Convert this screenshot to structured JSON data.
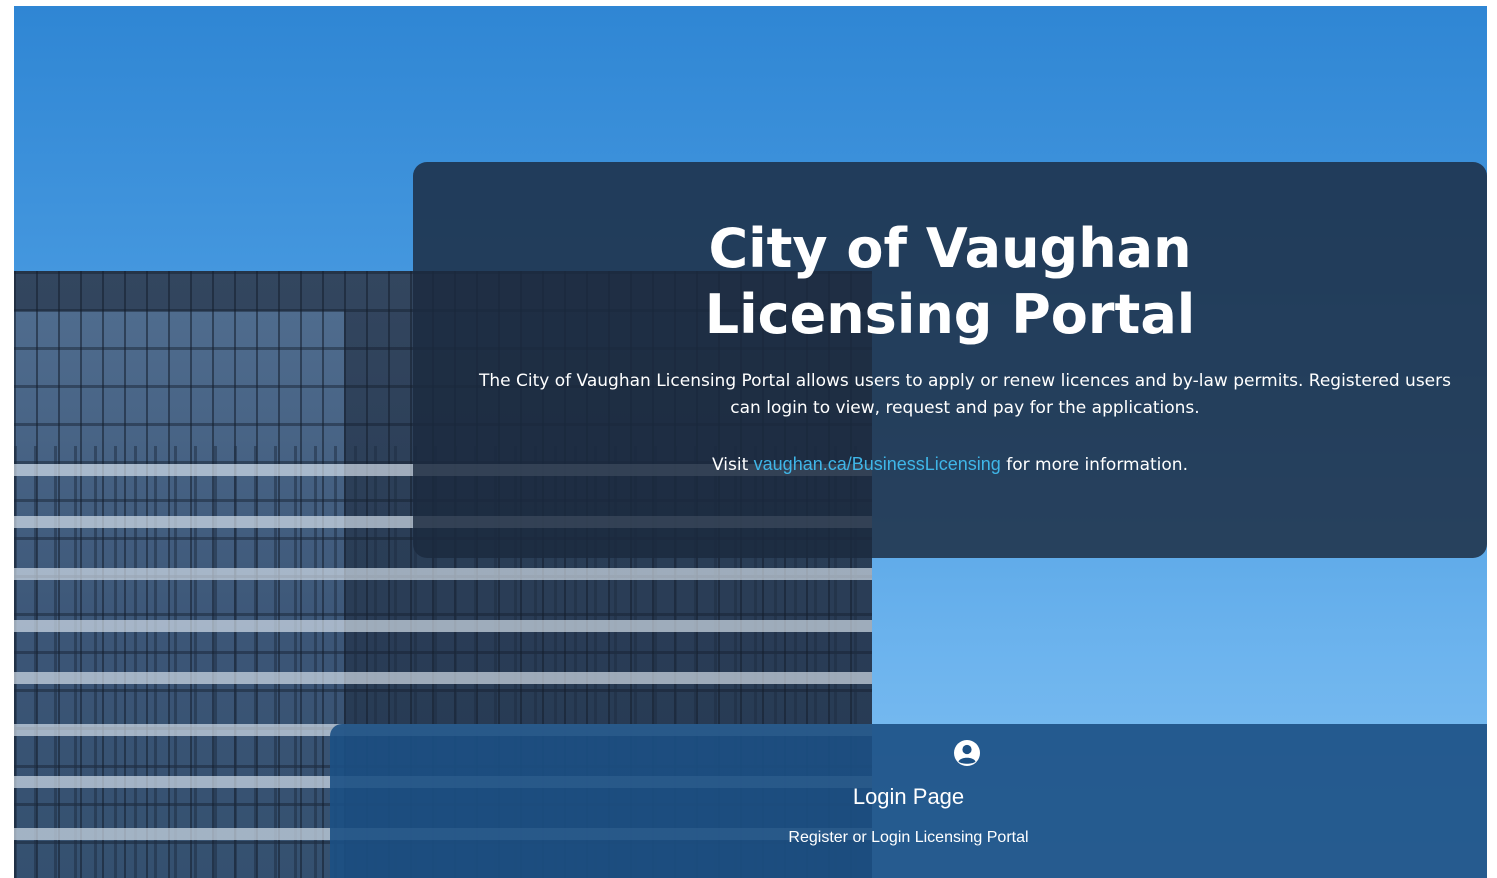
{
  "hero": {
    "title_line1": "City of Vaughan",
    "title_line2": "Licensing Portal",
    "description": "The City of Vaughan Licensing Portal allows users to apply or renew licences and by-law permits. Registered users can login to view, request and pay for the applications.",
    "visit_prefix": "Visit",
    "visit_link": "vaughan.ca/BusinessLicensing",
    "visit_suffix": "for more information."
  },
  "login_card": {
    "icon": "user-circle-icon",
    "title": "Login Page",
    "subtitle": "Register or Login Licensing Portal"
  },
  "colors": {
    "panel_bg": "#1b2a3e",
    "login_bg": "#1c5084",
    "link": "#3fb6e8",
    "sky": "#4e9fe3"
  }
}
